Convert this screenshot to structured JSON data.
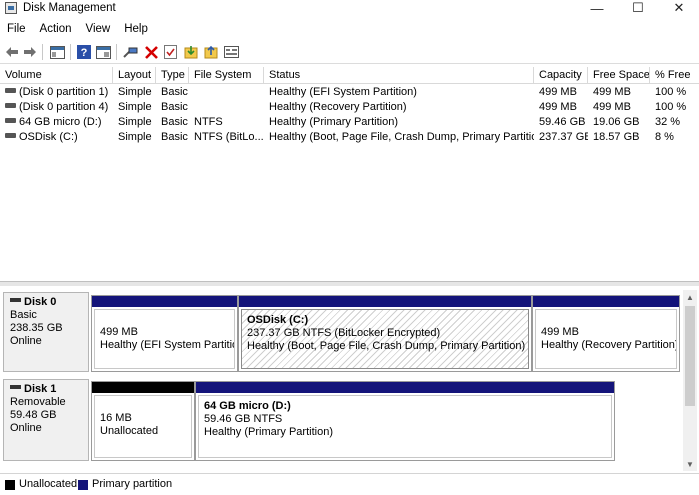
{
  "window": {
    "title": "Disk Management",
    "minimize_glyph": "—",
    "maximize_glyph": "☐",
    "close_glyph": "✕"
  },
  "menu": [
    "File",
    "Action",
    "View",
    "Help"
  ],
  "toolbar": {
    "icons": [
      "back-arrow-icon",
      "forward-arrow-icon",
      "properties-pane-icon",
      "help-icon",
      "help-topics-icon",
      "connect-icon",
      "delete-icon",
      "check-icon",
      "import-icon",
      "export-icon",
      "view-icon"
    ]
  },
  "table": {
    "columns": [
      "Volume",
      "Layout",
      "Type",
      "File System",
      "Status",
      "Capacity",
      "Free Space",
      "% Free"
    ],
    "rows": [
      {
        "volume": "(Disk 0 partition 1)",
        "layout": "Simple",
        "type": "Basic",
        "fs": "",
        "status": "Healthy (EFI System Partition)",
        "capacity": "499 MB",
        "free": "499 MB",
        "pct": "100 %"
      },
      {
        "volume": "(Disk 0 partition 4)",
        "layout": "Simple",
        "type": "Basic",
        "fs": "",
        "status": "Healthy (Recovery Partition)",
        "capacity": "499 MB",
        "free": "499 MB",
        "pct": "100 %"
      },
      {
        "volume": "64 GB micro (D:)",
        "layout": "Simple",
        "type": "Basic",
        "fs": "NTFS",
        "status": "Healthy (Primary Partition)",
        "capacity": "59.46 GB",
        "free": "19.06 GB",
        "pct": "32 %"
      },
      {
        "volume": "OSDisk (C:)",
        "layout": "Simple",
        "type": "Basic",
        "fs": "NTFS (BitLo...",
        "status": "Healthy (Boot, Page File, Crash Dump, Primary Partition)",
        "capacity": "237.37 GB",
        "free": "18.57 GB",
        "pct": "8 %"
      }
    ]
  },
  "disks": [
    {
      "name": "Disk 0",
      "kind": "Basic",
      "size": "238.35 GB",
      "state": "Online",
      "partitions": [
        {
          "name": "",
          "size": "499 MB",
          "status": "Healthy (EFI System Partition)"
        },
        {
          "name": "OSDisk  (C:)",
          "size": "237.37 GB NTFS (BitLocker Encrypted)",
          "status": "Healthy (Boot, Page File, Crash Dump, Primary Partition)"
        },
        {
          "name": "",
          "size": "499 MB",
          "status": "Healthy (Recovery Partition)"
        }
      ]
    },
    {
      "name": "Disk 1",
      "kind": "Removable",
      "size": "59.48 GB",
      "state": "Online",
      "partitions": [
        {
          "name": "",
          "size": "16 MB",
          "status": "Unallocated"
        },
        {
          "name": "64 GB micro  (D:)",
          "size": "59.46 GB NTFS",
          "status": "Healthy (Primary Partition)"
        }
      ]
    }
  ],
  "legend": [
    {
      "label": "Unallocated",
      "color": "#000000"
    },
    {
      "label": "Primary partition",
      "color": "#14147a"
    }
  ],
  "scroll": {
    "up_glyph": "▲",
    "down_glyph": "▼"
  }
}
